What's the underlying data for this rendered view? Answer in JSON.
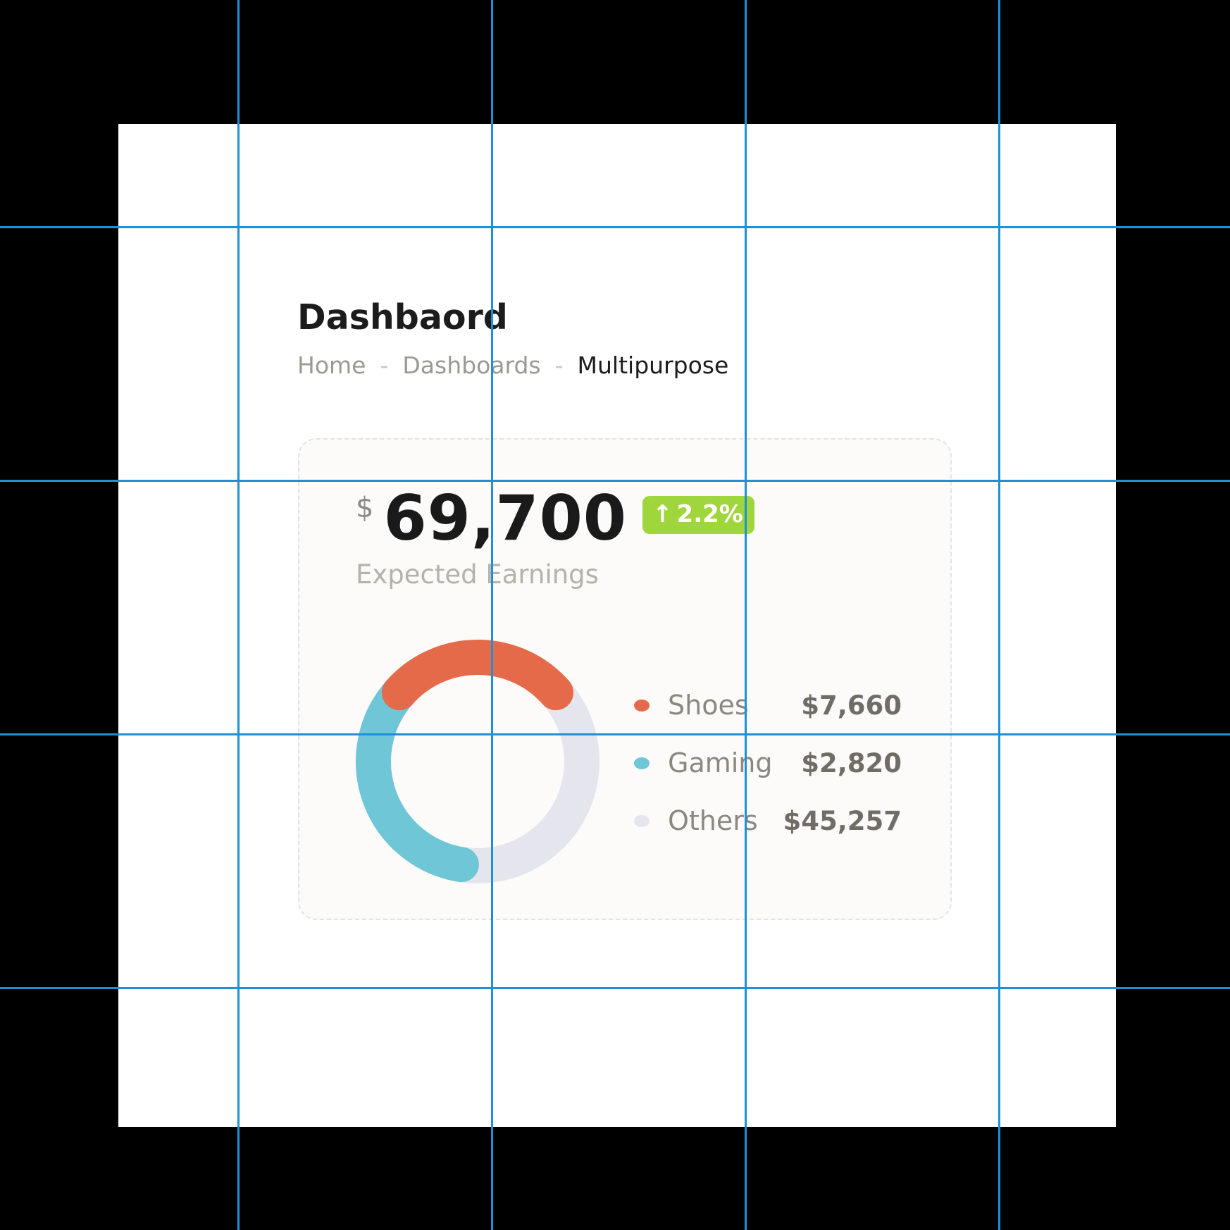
{
  "page": {
    "title": "Dashbaord",
    "breadcrumb": {
      "items": [
        "Home",
        "Dashboards"
      ],
      "separator": "-",
      "current": "Multipurpose"
    }
  },
  "earnings_card": {
    "currency_symbol": "$",
    "amount": "69,700",
    "change_badge": {
      "icon": "arrow-up-icon",
      "arrow": "↑",
      "text": "2.2%",
      "color": "#9fd63b"
    },
    "subtitle": "Expected Earnings"
  },
  "chart_data": {
    "type": "pie",
    "categories": [
      "Shoes",
      "Gaming",
      "Others"
    ],
    "display_values": [
      "$7,660",
      "$2,820",
      "$45,257"
    ],
    "values": [
      7660,
      2820,
      45257
    ],
    "arc_fractions": [
      0.27,
      0.34,
      0.39
    ],
    "colors": [
      "#e46a4a",
      "#6fc6d6",
      "#e5e5ee"
    ],
    "variant": "donut"
  }
}
